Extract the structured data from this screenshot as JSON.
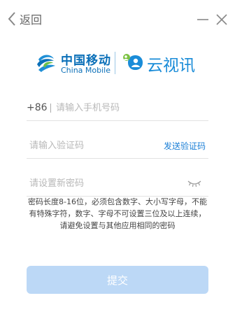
{
  "header": {
    "back_label": "返回"
  },
  "brand": {
    "partner_name_cn": "中国移动",
    "partner_name_en": "China Mobile",
    "product_name": "云视讯",
    "colors": {
      "partner": "#0a6fb8",
      "product": "#1a8cd8"
    }
  },
  "form": {
    "country_code": "+86",
    "phone_placeholder": "请输入手机号码",
    "code_placeholder": "请输入验证码",
    "send_code_label": "发送验证码",
    "password_placeholder": "请设置新密码",
    "password_hint": "密码长度8-16位，必须包含数字、大小写字母，不能有特殊字符，数字、字母不可设置三位及以上连续，请避免设置与其他应用相同的密码",
    "submit_label": "提交"
  },
  "icons": {
    "back": "chevron-left-icon",
    "minimize": "minimize-icon",
    "close": "close-icon",
    "partner_logo": "china-mobile-logo",
    "product_logo": "yunshixun-logo",
    "password_visibility": "eye-closed-icon"
  },
  "colors": {
    "accent": "#1b7fd6",
    "submit_disabled": "#bcd8f6",
    "placeholder": "#b8b8b8"
  }
}
